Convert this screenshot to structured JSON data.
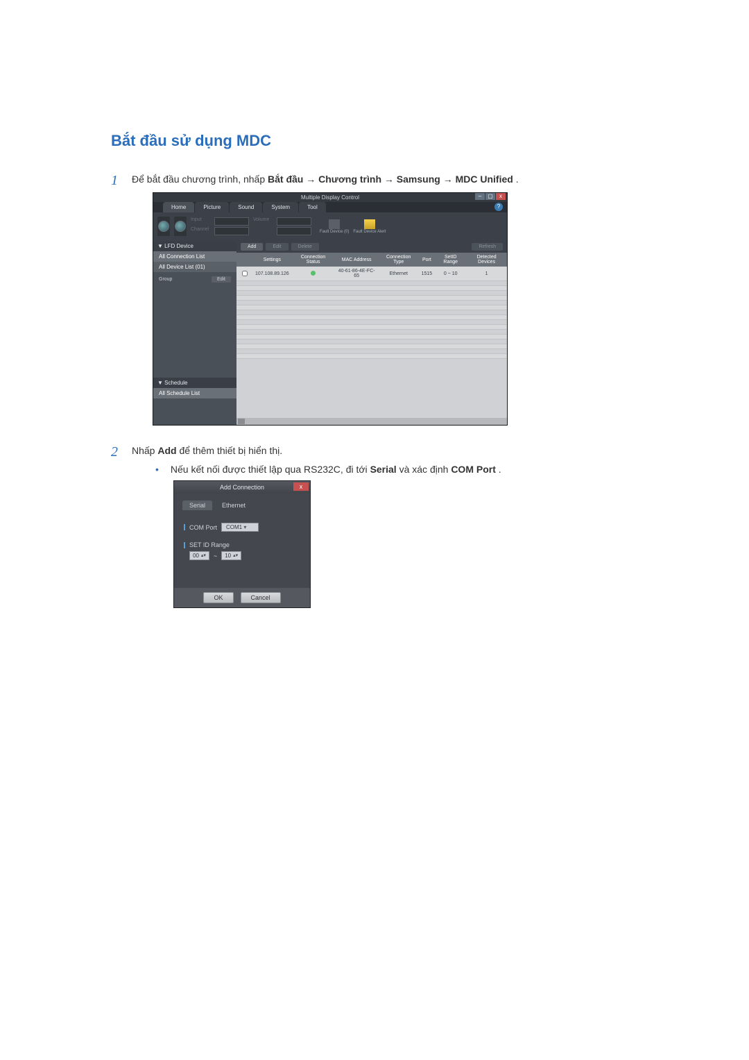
{
  "heading": "Bắt đầu sử dụng MDC",
  "step1": {
    "num": "1",
    "pre": "Để bắt đầu chương trình, nhấp ",
    "b1": "Bắt đầu",
    "a1": " → ",
    "b2": "Chương trình",
    "a2": " → ",
    "b3": "Samsung",
    "a3": " → ",
    "b4": "MDC Unified",
    "post": "."
  },
  "mdc": {
    "title": "Multiple Display Control",
    "help": "?",
    "win_min": "–",
    "win_max": "▢",
    "win_close": "x",
    "tabs": [
      "Home",
      "Picture",
      "Sound",
      "System",
      "Tool"
    ],
    "ribbon": {
      "input_label": "Input",
      "channel_label": "Channel",
      "volume_label": "Volume",
      "fault_device": "Fault Device (0)",
      "fault_alert": "Fault Device Alert"
    },
    "toolbar": {
      "add": "Add",
      "edit": "Edit",
      "delete": "Delete",
      "refresh": "Refresh"
    },
    "sidebar": {
      "lfd_hdr": "▼  LFD Device",
      "all_conn": "All Connection List",
      "all_dev": "All Device List (01)",
      "group_label": "Group",
      "group_edit": "Edit",
      "sched_hdr": "▼  Schedule",
      "sched_all": "All Schedule List"
    },
    "table": {
      "headers": [
        "",
        "Settings",
        "Connection Status",
        "MAC Address",
        "Connection Type",
        "Port",
        "SetID Range",
        "Detected Devices"
      ],
      "row": {
        "settings": "107.108.89.126",
        "mac": "40-61-86-4E-FC-65",
        "conn_type": "Ethernet",
        "port": "1515",
        "range": "0 ~ 10",
        "detected": "1"
      }
    }
  },
  "step2": {
    "num": "2",
    "pre": "Nhấp ",
    "b1": "Add",
    "post": " để thêm thiết bị hiển thị."
  },
  "bullet1": {
    "pre": "Nếu kết nối được thiết lập qua RS232C, đi tới ",
    "b1": "Serial",
    "mid": " và xác định ",
    "b2": "COM Port",
    "post": "."
  },
  "dialog": {
    "title": "Add Connection",
    "close": "x",
    "tab_serial": "Serial",
    "tab_eth": "Ethernet",
    "com_port_label": "COM Port",
    "com_port_value": "COM1",
    "setid_label": "SET ID Range",
    "range_from": "00",
    "range_sep": "~",
    "range_to": "10",
    "ok": "OK",
    "cancel": "Cancel"
  }
}
